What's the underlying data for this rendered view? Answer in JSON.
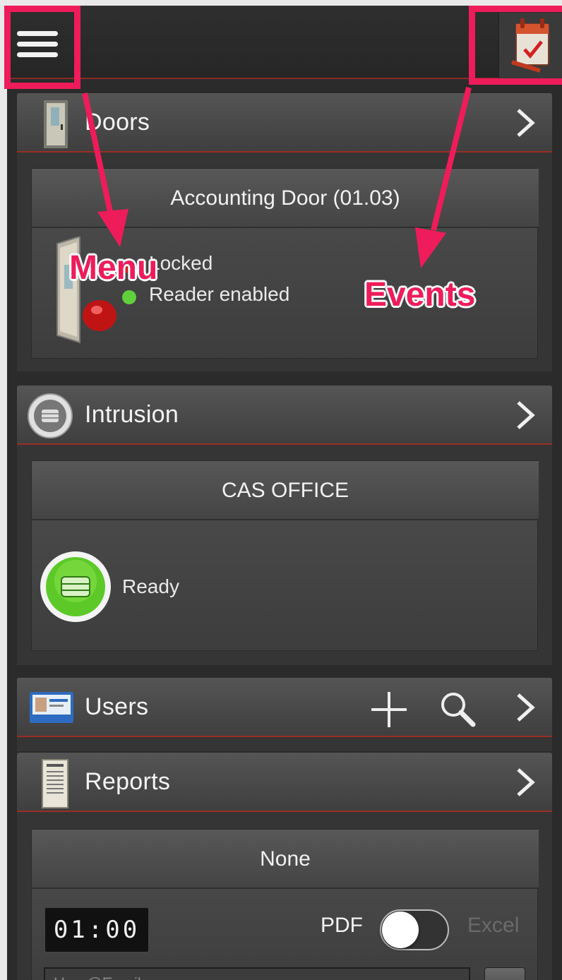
{
  "header": {
    "menu_icon": "hamburger-menu-icon",
    "events_icon": "events-calendar-icon"
  },
  "doors": {
    "title": "Doors",
    "icon": "door-icon",
    "card": {
      "title": "Accounting Door (01.03)",
      "status_lines": [
        "Locked",
        "Reader enabled"
      ],
      "status_colors": [
        "#d02020",
        "#5fd03c"
      ]
    }
  },
  "intrusion": {
    "title": "Intrusion",
    "icon": "keypad-icon",
    "card": {
      "title": "CAS OFFICE",
      "status": "Ready",
      "status_color": "#5cc928"
    }
  },
  "users": {
    "title": "Users",
    "icon": "id-card-icon"
  },
  "reports": {
    "title": "Reports",
    "icon": "report-document-icon",
    "card": {
      "title": "None",
      "time": "01:00",
      "pdf_label": "PDF",
      "excel_label": "Excel",
      "email_placeholder": "User@Email.com"
    }
  },
  "annotations": {
    "menu_label": "Menu",
    "events_label": "Events",
    "color": "#ee1c5a"
  }
}
